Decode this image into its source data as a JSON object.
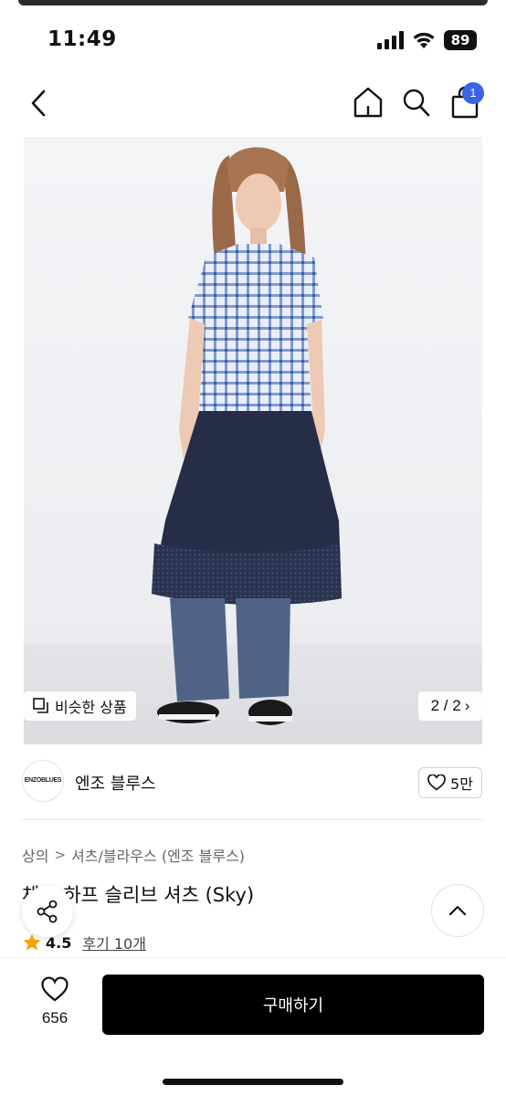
{
  "status_bar": {
    "time": "11:49",
    "battery": "89"
  },
  "nav": {
    "cart_count": "1"
  },
  "gallery": {
    "similar_label": "비슷한 상품",
    "page_indicator": "2 / 2",
    "page_next": "›"
  },
  "brand": {
    "logo_text": "ENZOBLUES",
    "name": "엔조 블루스",
    "likes": "5만"
  },
  "breadcrumb": {
    "category": "상의",
    "separator": ">",
    "subcategory": "셔츠/블라우스 (엔조 블루스)"
  },
  "product": {
    "title": "체크 하프 슬리브 셔츠 (Sky)",
    "rating": "4.5",
    "reviews": "후기 10개"
  },
  "bottom": {
    "wish_count": "656",
    "buy_label": "구매하기"
  },
  "colors": {
    "accent_badge": "#3a63e8",
    "star": "#f2a20c",
    "buy_button": "#000000"
  }
}
